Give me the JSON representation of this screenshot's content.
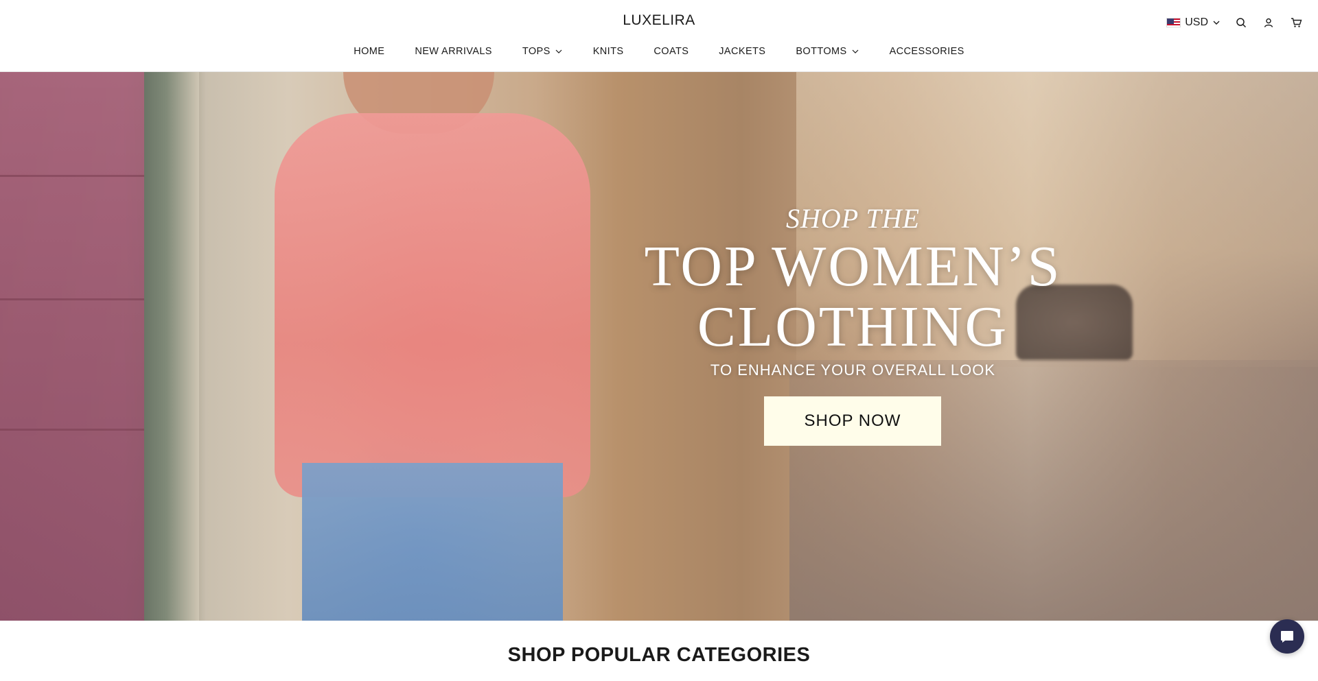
{
  "header": {
    "logo": "LUXELIRA",
    "currency": "USD",
    "icons": [
      "us-flag-icon",
      "chevron-down-icon",
      "search-icon",
      "account-icon",
      "cart-icon"
    ]
  },
  "nav": {
    "items": [
      {
        "label": "HOME",
        "has_dropdown": false
      },
      {
        "label": "NEW ARRIVALS",
        "has_dropdown": false
      },
      {
        "label": "TOPS",
        "has_dropdown": true
      },
      {
        "label": "KNITS",
        "has_dropdown": false
      },
      {
        "label": "COATS",
        "has_dropdown": false
      },
      {
        "label": "JACKETS",
        "has_dropdown": false
      },
      {
        "label": "BOTTOMS",
        "has_dropdown": true
      },
      {
        "label": "ACCESSORIES",
        "has_dropdown": false
      }
    ]
  },
  "hero": {
    "eyebrow": "SHOP THE",
    "headline_line1": "TOP WOMEN’S",
    "headline_line2": "CLOTHING",
    "subhead": "TO ENHANCE YOUR OVERALL LOOK",
    "cta_label": "SHOP NOW",
    "cta_background": "#fffdea"
  },
  "section": {
    "title": "SHOP POPULAR CATEGORIES"
  },
  "chat": {
    "icon": "chat-bubble-icon",
    "color": "#2b2d52"
  }
}
